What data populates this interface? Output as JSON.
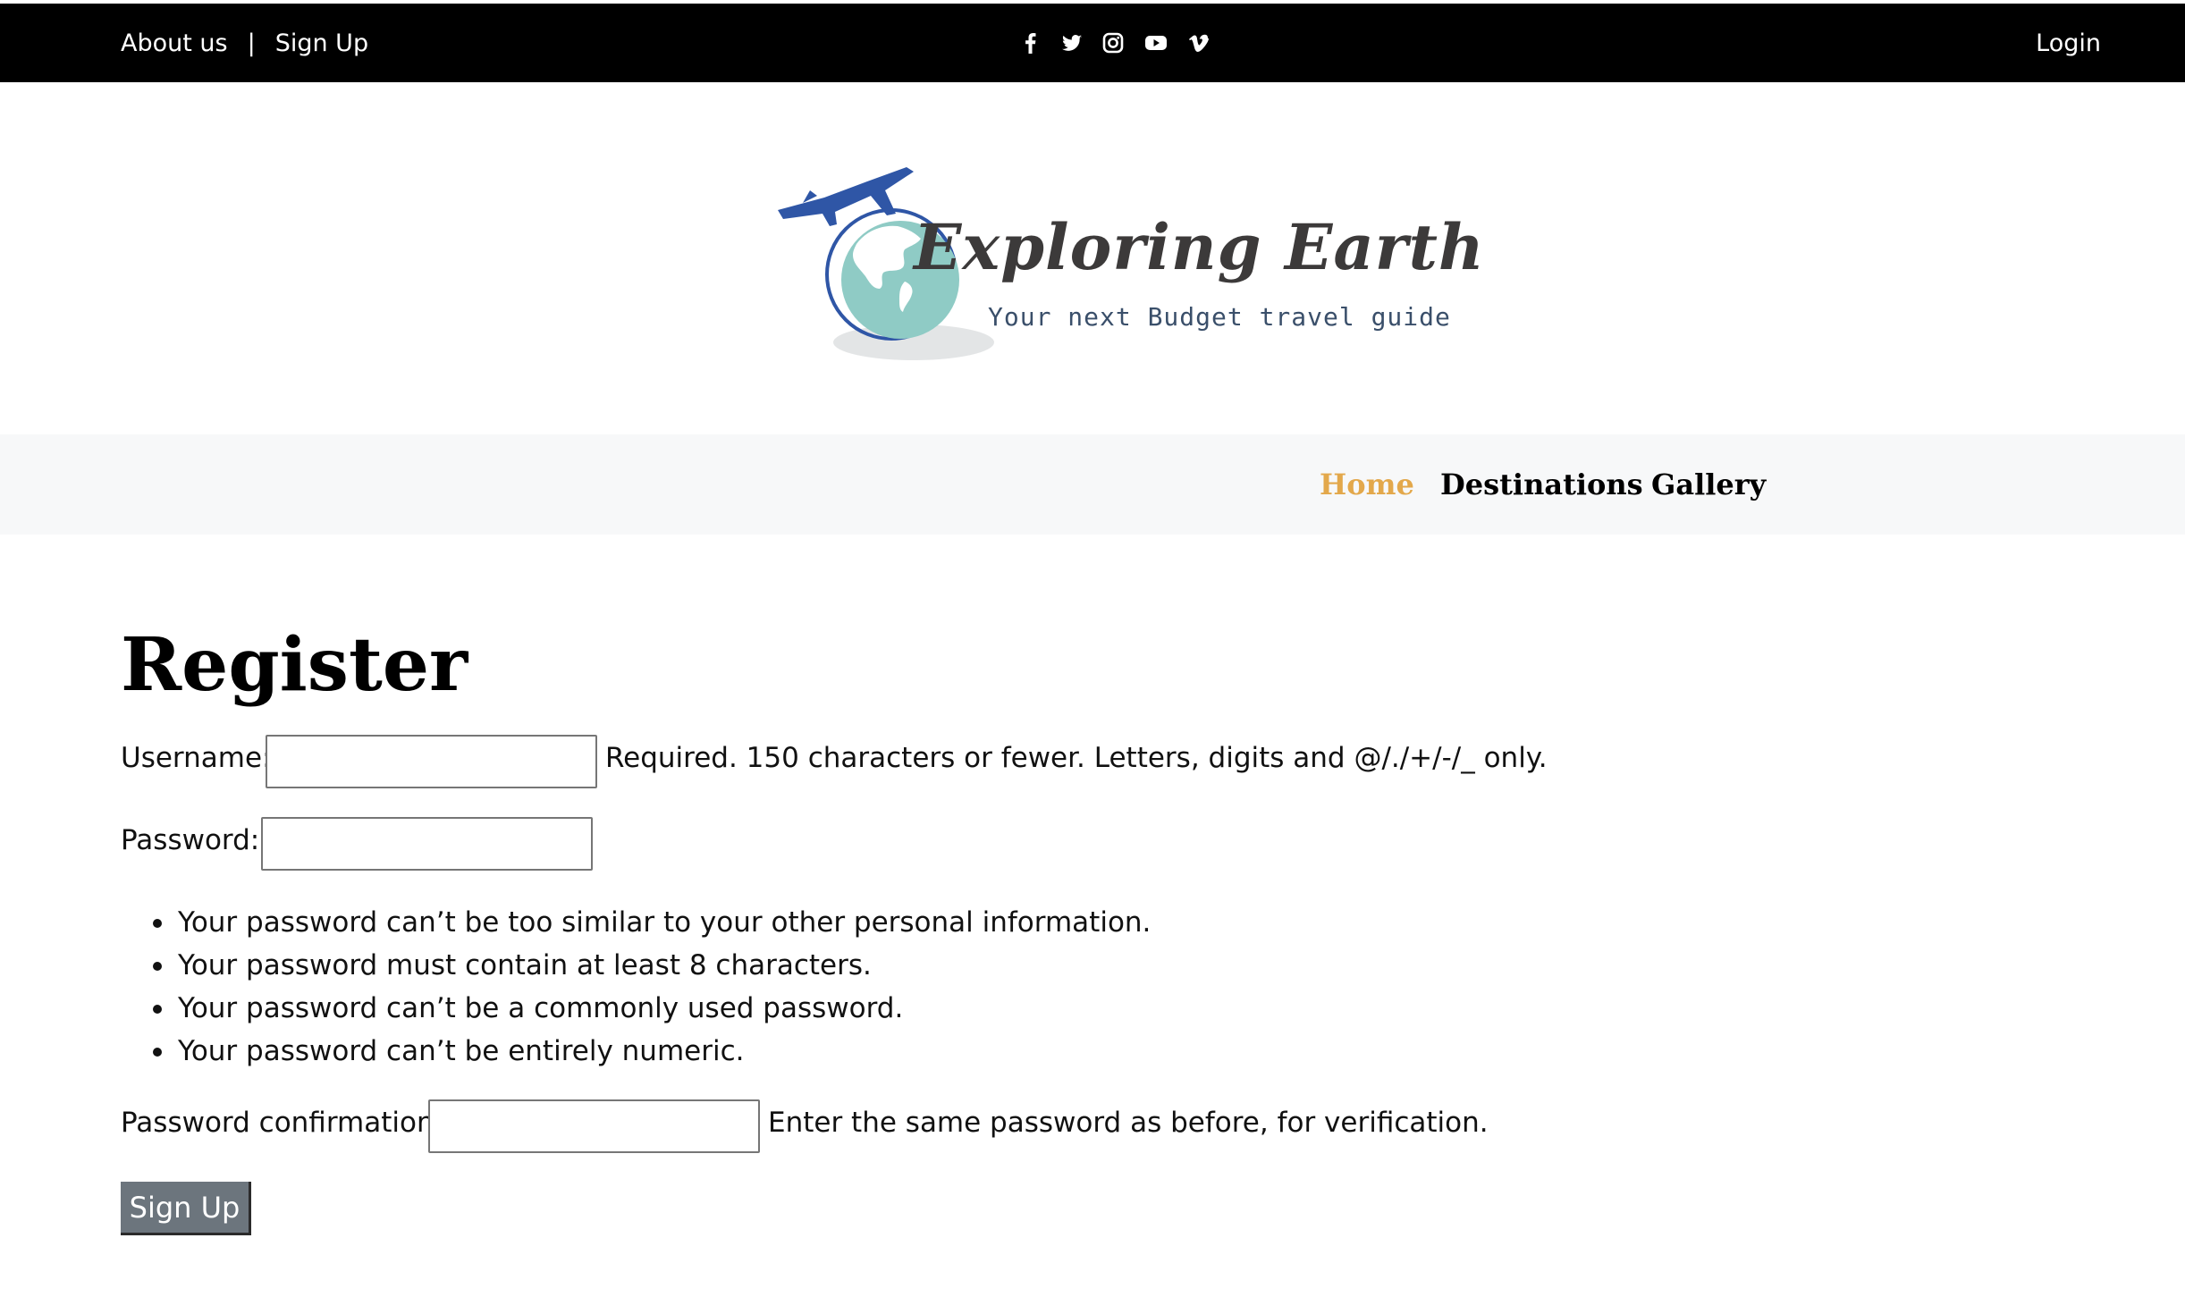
{
  "topbar": {
    "about": "About us",
    "separator": "|",
    "signup": "Sign Up",
    "login": "Login",
    "social_icons": [
      "facebook-icon",
      "twitter-icon",
      "instagram-icon",
      "youtube-icon",
      "vimeo-icon"
    ]
  },
  "logo": {
    "title": "Exploring Earth",
    "tagline": "Your next Budget travel guide"
  },
  "nav": {
    "items": [
      {
        "label": "Home",
        "active": true
      },
      {
        "label": "Destinations",
        "active": false
      },
      {
        "label": "Gallery",
        "active": false
      }
    ]
  },
  "form": {
    "title": "Register",
    "username": {
      "label": "Username:",
      "value": "",
      "help": "Required. 150 characters or fewer. Letters, digits and @/./+/-/_ only."
    },
    "password": {
      "label": "Password:",
      "value": "",
      "rules": [
        "Your password can’t be too similar to your other personal information.",
        "Your password must contain at least 8 characters.",
        "Your password can’t be a commonly used password.",
        "Your password can’t be entirely numeric."
      ]
    },
    "password_confirmation": {
      "label": "Password confirmation:",
      "value": "",
      "help": "Enter the same password as before, for verification."
    },
    "submit": "Sign Up"
  },
  "colors": {
    "topbar_bg": "#000000",
    "navbar_bg": "#f7f8f9",
    "nav_active": "#e3a84b",
    "button_bg": "#6c757d"
  }
}
